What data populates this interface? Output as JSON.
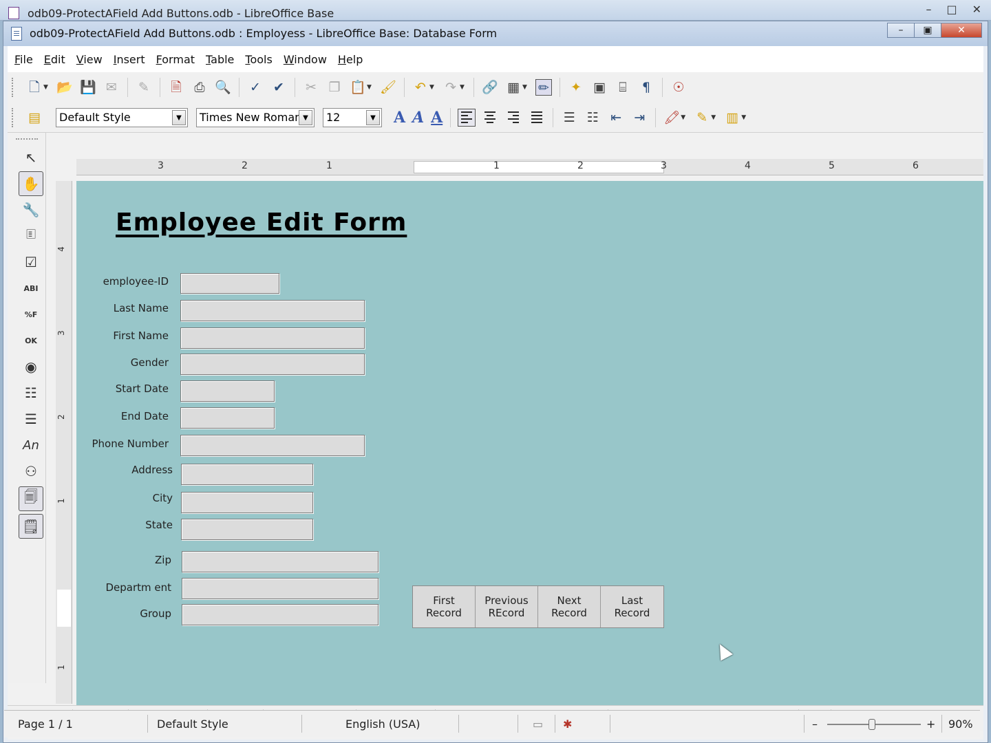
{
  "bg_window": {
    "title": "odb09-ProtectAField Add Buttons.odb - LibreOffice Base"
  },
  "window": {
    "title": "odb09-ProtectAField Add Buttons.odb : Employess - LibreOffice Base: Database Form"
  },
  "menu": [
    "File",
    "Edit",
    "View",
    "Insert",
    "Format",
    "Table",
    "Tools",
    "Window",
    "Help"
  ],
  "format_bar": {
    "style": "Default Style",
    "font": "Times New Roman",
    "size": "12"
  },
  "ruler": {
    "h_ticks": [
      "3",
      "2",
      "1",
      "1",
      "2",
      "3",
      "4",
      "5",
      "6"
    ],
    "v_ticks": [
      "4",
      "3",
      "2",
      "1",
      "1"
    ]
  },
  "form": {
    "title": "Employee Edit Form",
    "fields": [
      {
        "label": "employee-ID",
        "value": ""
      },
      {
        "label": "Last Name",
        "value": ""
      },
      {
        "label": "First Name",
        "value": ""
      },
      {
        "label": "Gender",
        "value": ""
      },
      {
        "label": "Start Date",
        "value": ""
      },
      {
        "label": "End Date",
        "value": ""
      },
      {
        "label": "Phone Number",
        "value": ""
      },
      {
        "label": "Address",
        "value": ""
      },
      {
        "label": "City",
        "value": ""
      },
      {
        "label": "State",
        "value": ""
      },
      {
        "label": "Zip",
        "value": ""
      },
      {
        "label": "Departm ent",
        "value": ""
      },
      {
        "label": "Group",
        "value": ""
      }
    ],
    "nav_buttons": [
      {
        "label": "First\nRecord"
      },
      {
        "label": "Previous\nREcord"
      },
      {
        "label": "Next\nRecord"
      },
      {
        "label": "Last\nRecord"
      }
    ]
  },
  "status": {
    "page": "Page 1 / 1",
    "style": "Default Style",
    "language": "English (USA)",
    "zoom": "90%"
  }
}
